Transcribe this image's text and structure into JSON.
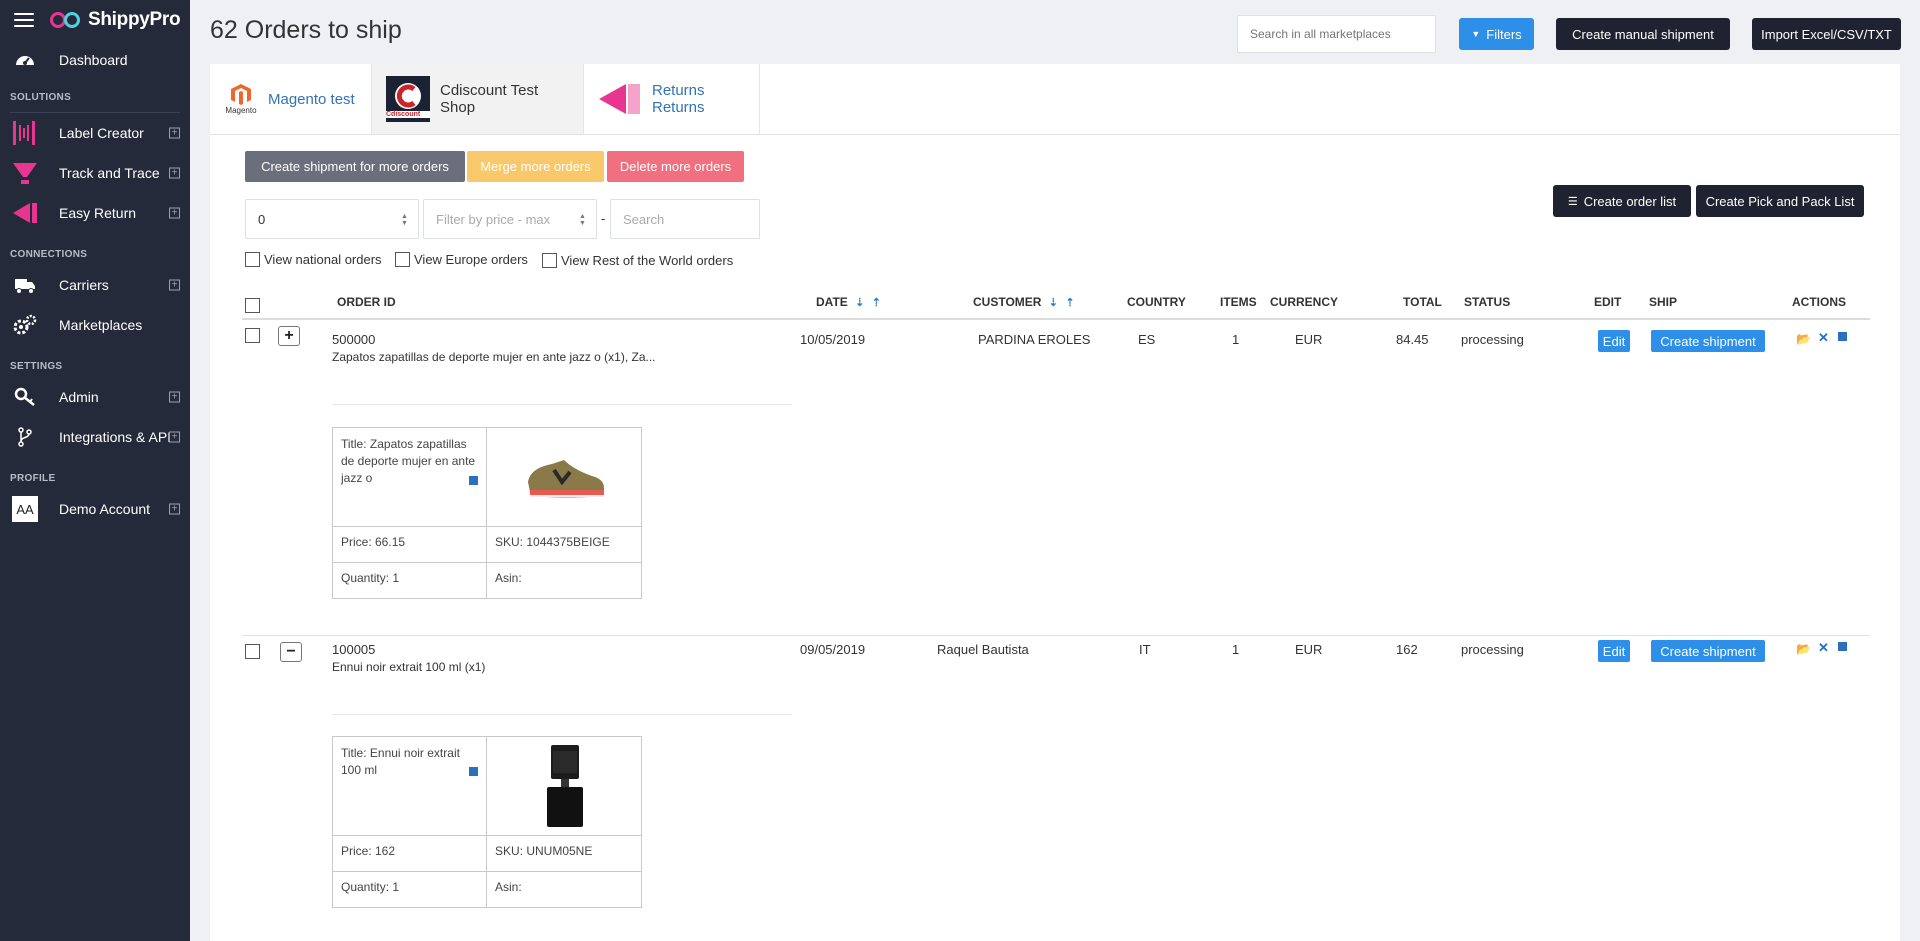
{
  "app": {
    "name": "ShippyPro"
  },
  "sidebar": {
    "dashboard": "Dashboard",
    "sections": {
      "solutions": "SOLUTIONS",
      "connections": "CONNECTIONS",
      "settings": "SETTINGS",
      "profile": "PROFILE"
    },
    "solutions": [
      {
        "label": "Label Creator",
        "icon": "barcode-icon"
      },
      {
        "label": "Track and Trace",
        "icon": "funnel-icon"
      },
      {
        "label": "Easy Return",
        "icon": "return-arrow-icon"
      }
    ],
    "connections": [
      {
        "label": "Carriers",
        "icon": "truck-icon"
      },
      {
        "label": "Marketplaces",
        "icon": "gears-icon"
      }
    ],
    "settings": [
      {
        "label": "Admin",
        "icon": "key-icon"
      },
      {
        "label": "Integrations & API",
        "icon": "branch-icon"
      }
    ],
    "profile": {
      "label": "Demo Account",
      "avatar": "AA"
    }
  },
  "header": {
    "title": "62 Orders to ship",
    "search_placeholder": "Search in all marketplaces",
    "filters_label": "Filters",
    "create_manual_label": "Create manual shipment",
    "import_label": "Import Excel/CSV/TXT"
  },
  "tabs": [
    {
      "label": "Magento test",
      "logo": "Magento"
    },
    {
      "label": "Cdiscount Test Shop",
      "logo": "Cdiscount"
    },
    {
      "label": "Returns Returns"
    }
  ],
  "bulk": {
    "create_more": "Create shipment for more orders",
    "merge_more": "Merge more orders",
    "delete_more": "Delete more orders",
    "create_order_list": "Create order list",
    "create_pick_pack": "Create Pick and Pack List"
  },
  "filters": {
    "price_min_value": "0",
    "price_max_placeholder": "Filter by price - max",
    "dash": "-",
    "search_placeholder": "Search",
    "national": "View national orders",
    "europe": "View Europe orders",
    "world": "View Rest of the World orders"
  },
  "table": {
    "columns": {
      "order_id": "ORDER ID",
      "date": "DATE",
      "customer": "CUSTOMER",
      "country": "COUNTRY",
      "items": "ITEMS",
      "currency": "CURRENCY",
      "total": "TOTAL",
      "status": "STATUS",
      "edit": "EDIT",
      "ship": "SHIP",
      "actions": "ACTIONS"
    },
    "edit_label": "Edit",
    "ship_label": "Create shipment",
    "orders": [
      {
        "toggle": "+",
        "id": "500000",
        "description": "Zapatos zapatillas de deporte mujer en ante jazz o (x1), Za...",
        "date": "10/05/2019",
        "customer": "PARDINA EROLES",
        "country": "ES",
        "items": "1",
        "currency": "EUR",
        "total": "84.45",
        "status": "processing",
        "product": {
          "title": "Title: Zapatos zapatillas de deporte mujer en ante jazz o",
          "price": "Price: 66.15",
          "sku": "SKU: 1044375BEIGE",
          "quantity": "Quantity: 1",
          "asin": "Asin:"
        }
      },
      {
        "toggle": "−",
        "id": "100005",
        "description": "Ennui noir extrait 100 ml (x1)",
        "date": "09/05/2019",
        "customer": "Raquel Bautista",
        "country": "IT",
        "items": "1",
        "currency": "EUR",
        "total": "162",
        "status": "processing",
        "product": {
          "title": "Title: Ennui noir extrait 100 ml",
          "price": "Price: 162",
          "sku": "SKU: UNUM05NE",
          "quantity": "Quantity: 1",
          "asin": "Asin:"
        }
      }
    ]
  },
  "colors": {
    "sidebar": "#252a3a",
    "primary": "#2d8fe8",
    "dark_button": "#1f2230",
    "merge": "#f9c86b",
    "delete": "#f0707f",
    "create_more": "#6b6f7c",
    "brand_pink": "#e8358f"
  }
}
